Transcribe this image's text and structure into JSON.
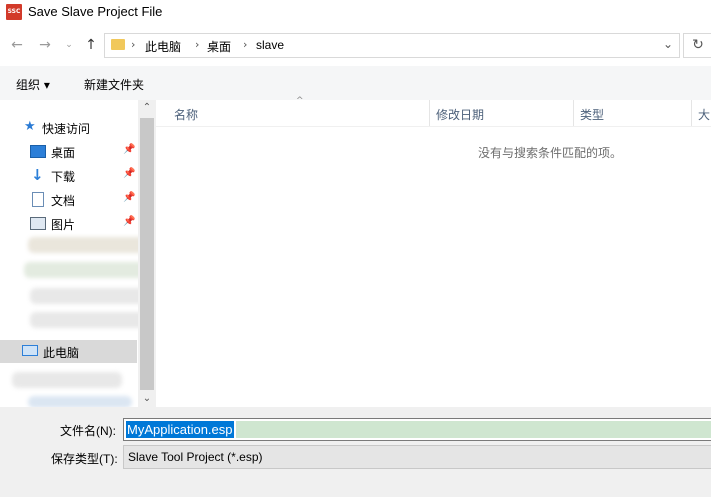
{
  "window": {
    "title": "Save Slave Project File",
    "app_icon_text": "SSC"
  },
  "nav": {
    "back_icon": "back-arrow-icon",
    "forward_icon": "forward-arrow-icon",
    "recent_icon": "chevron-down-icon",
    "up_icon": "up-arrow-icon",
    "breadcrumb": [
      "此电脑",
      "桌面",
      "slave"
    ],
    "refresh_icon": "refresh-icon"
  },
  "toolbar": {
    "organize_label": "组织 ▾",
    "new_folder_label": "新建文件夹"
  },
  "sidebar": {
    "quick_access": "快速访问",
    "items": [
      {
        "label": "桌面",
        "icon": "desktop-icon",
        "pinned": true
      },
      {
        "label": "下载",
        "icon": "download-icon",
        "pinned": true
      },
      {
        "label": "文档",
        "icon": "document-icon",
        "pinned": true
      },
      {
        "label": "图片",
        "icon": "picture-icon",
        "pinned": true
      }
    ],
    "this_pc": "此电脑"
  },
  "filelist": {
    "columns": [
      "名称",
      "修改日期",
      "类型",
      "大"
    ],
    "empty_message": "没有与搜索条件匹配的项。"
  },
  "bottom": {
    "filename_label": "文件名(N):",
    "filename_value": "MyApplication.esp",
    "filetype_label": "保存类型(T):",
    "filetype_value": "Slave Tool Project  (*.esp)"
  },
  "colors": {
    "selection": "#0078d7",
    "nav_selected": "#d9d9d9",
    "header_text": "#4c607a"
  }
}
